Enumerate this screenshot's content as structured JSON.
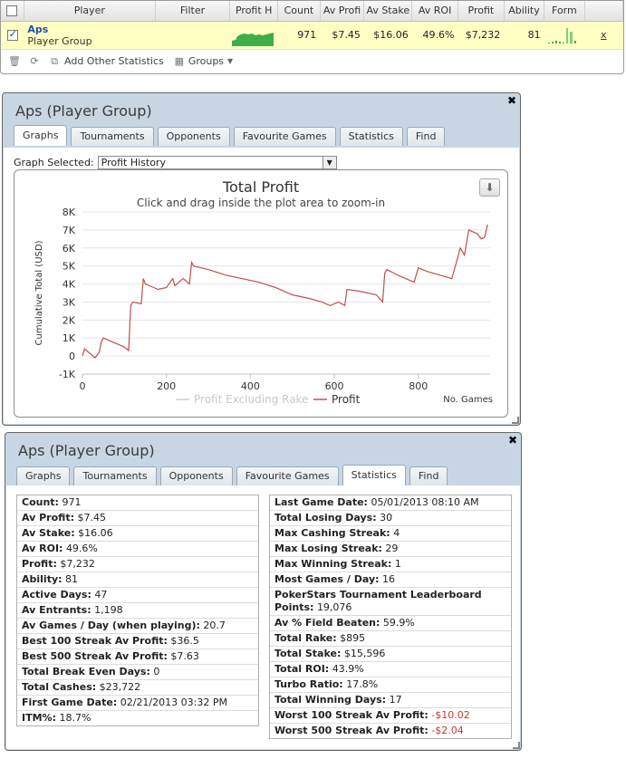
{
  "results": {
    "columns": [
      "Player",
      "Filter",
      "Profit H",
      "Count",
      "Av Profi",
      "Av Stake",
      "Av ROI",
      "Profit",
      "Ability",
      "Form"
    ],
    "row": {
      "name": "Aps",
      "group": "Player Group",
      "filter": "",
      "count": "971",
      "av_profit": "$7.45",
      "av_stake": "$16.06",
      "av_roi": "49.6%",
      "profit": "$7,232",
      "ability": "81",
      "remove_label": "x"
    },
    "toolbar": {
      "add_stats_label": "Add Other Statistics",
      "groups_label": "Groups"
    },
    "spark_color": "#3fae49"
  },
  "graph_panel": {
    "title": "Aps (Player Group)",
    "tabs": [
      "Graphs",
      "Tournaments",
      "Opponents",
      "Favourite Games",
      "Statistics",
      "Find"
    ],
    "active_tab": "Graphs",
    "graph_selected_label": "Graph Selected:",
    "graph_selected_value": "Profit History"
  },
  "chart_data": {
    "type": "line",
    "title": "Total Profit",
    "subtitle": "Click and drag inside the plot area to zoom-in",
    "xlabel": "No. Games",
    "ylabel": "Cumulative Total (USD)",
    "xlim": [
      0,
      971
    ],
    "ylim": [
      -1000,
      8000
    ],
    "xticks": [
      0,
      200,
      400,
      600,
      800
    ],
    "yticks": [
      -1000,
      0,
      1000,
      2000,
      3000,
      4000,
      5000,
      6000,
      7000,
      8000
    ],
    "ytick_labels": [
      "-1K",
      "0",
      "1K",
      "2K",
      "3K",
      "4K",
      "5K",
      "6K",
      "7K",
      "8K"
    ],
    "legend": [
      "Profit Excluding Rake",
      "Profit"
    ],
    "legend_placement": "bottom",
    "series": [
      {
        "name": "Profit",
        "color": "#c0504d",
        "x": [
          0,
          5,
          10,
          20,
          30,
          40,
          45,
          50,
          60,
          80,
          100,
          110,
          115,
          120,
          140,
          145,
          150,
          160,
          180,
          200,
          215,
          220,
          240,
          255,
          260,
          265,
          300,
          340,
          380,
          420,
          460,
          500,
          540,
          570,
          590,
          610,
          625,
          630,
          660,
          700,
          715,
          720,
          725,
          750,
          770,
          790,
          800,
          820,
          850,
          880,
          900,
          910,
          920,
          940,
          950,
          958,
          965
        ],
        "y": [
          0,
          400,
          300,
          100,
          -100,
          200,
          800,
          1000,
          900,
          700,
          500,
          300,
          2800,
          3000,
          2900,
          4300,
          4000,
          3900,
          3700,
          3800,
          4300,
          3900,
          4300,
          4000,
          5200,
          5000,
          4800,
          4500,
          4300,
          4100,
          3800,
          3400,
          3200,
          3000,
          2800,
          3000,
          2800,
          3700,
          3600,
          3400,
          3000,
          4600,
          4800,
          4500,
          4300,
          4100,
          4900,
          4700,
          4500,
          4300,
          6000,
          5600,
          7000,
          6800,
          6500,
          6600,
          7300
        ]
      }
    ]
  },
  "stats_panel": {
    "title": "Aps (Player Group)",
    "tabs": [
      "Graphs",
      "Tournaments",
      "Opponents",
      "Favourite Games",
      "Statistics",
      "Find"
    ],
    "active_tab": "Statistics",
    "left": [
      {
        "label": "Count:",
        "value": "971"
      },
      {
        "label": "Av Profit:",
        "value": "$7.45"
      },
      {
        "label": "Av Stake:",
        "value": "$16.06"
      },
      {
        "label": "Av ROI:",
        "value": "49.6%"
      },
      {
        "label": "Profit:",
        "value": "$7,232"
      },
      {
        "label": "Ability:",
        "value": "81"
      },
      {
        "label": "Active Days:",
        "value": "47"
      },
      {
        "label": "Av Entrants:",
        "value": "1,198"
      },
      {
        "label": "Av Games / Day (when playing):",
        "value": "20.7"
      },
      {
        "label": "Best 100 Streak Av Profit:",
        "value": "$36.5"
      },
      {
        "label": "Best 500 Streak Av Profit:",
        "value": "$7.63"
      },
      {
        "label": "Total Break Even Days:",
        "value": "0"
      },
      {
        "label": "Total Cashes:",
        "value": "$23,722"
      },
      {
        "label": "First Game Date:",
        "value": "02/21/2013 03:32 PM"
      },
      {
        "label": "ITM%:",
        "value": "18.7%"
      }
    ],
    "right": [
      {
        "label": "Last Game Date:",
        "value": "05/01/2013 08:10 AM"
      },
      {
        "label": "Total Losing Days:",
        "value": "30"
      },
      {
        "label": "Max Cashing Streak:",
        "value": "4"
      },
      {
        "label": "Max Losing Streak:",
        "value": "29"
      },
      {
        "label": "Max Winning Streak:",
        "value": "1"
      },
      {
        "label": "Most Games / Day:",
        "value": "16"
      },
      {
        "label": "PokerStars Tournament Leaderboard Points:",
        "value": "19,076"
      },
      {
        "label": "Av % Field Beaten:",
        "value": "59.9%"
      },
      {
        "label": "Total Rake:",
        "value": "$895"
      },
      {
        "label": "Total Stake:",
        "value": "$15,596"
      },
      {
        "label": "Total ROI:",
        "value": "43.9%"
      },
      {
        "label": "Turbo Ratio:",
        "value": "17.8%"
      },
      {
        "label": "Total Winning Days:",
        "value": "17"
      },
      {
        "label": "Worst 100 Streak Av Profit:",
        "value": "-$10.02"
      },
      {
        "label": "Worst 500 Streak Av Profit:",
        "value": "-$2.04"
      }
    ],
    "negative_color": "#c0392b"
  }
}
